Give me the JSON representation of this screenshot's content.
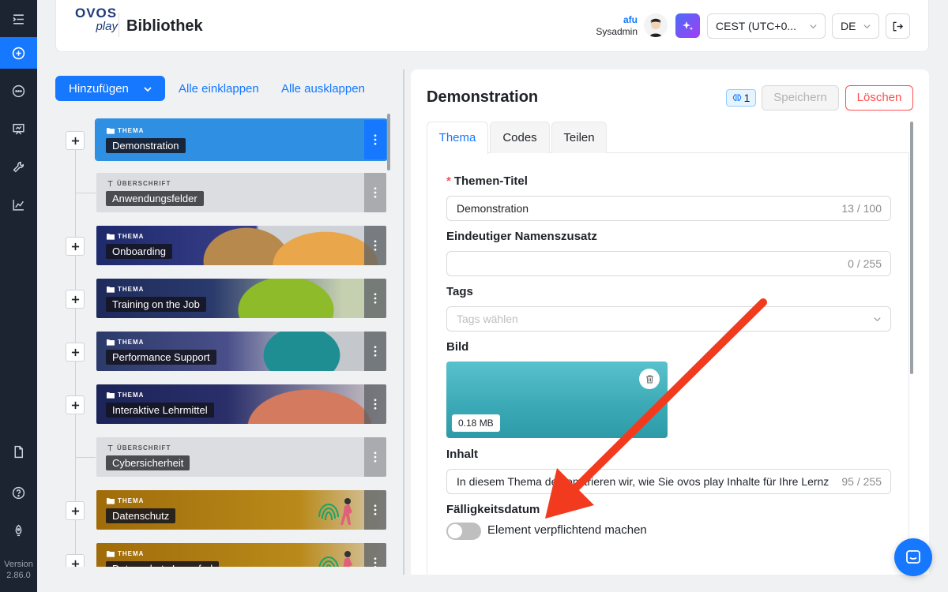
{
  "app": {
    "title": "Bibliothek",
    "logo_line1": "OVOS",
    "logo_line2": "play",
    "version_label": "Version",
    "version": "2.86.0"
  },
  "sidebar": {
    "items": [
      {
        "icon": "menu-fold-icon"
      },
      {
        "icon": "plus-circle-icon",
        "active": true
      },
      {
        "icon": "message-icon"
      },
      {
        "icon": "presentation-icon"
      },
      {
        "icon": "tool-icon"
      },
      {
        "icon": "line-chart-icon"
      },
      {
        "icon": "file-icon"
      },
      {
        "icon": "question-circle-icon"
      },
      {
        "icon": "rocket-icon"
      }
    ]
  },
  "header": {
    "user_name": "afu",
    "user_role": "Sysadmin",
    "timezone": "CEST (UTC+0...",
    "language": "DE"
  },
  "library": {
    "add_label": "Hinzufügen",
    "collapse_all": "Alle einklappen",
    "expand_all": "Alle ausklappen",
    "items": [
      {
        "type": "THEMA",
        "label": "Demonstration",
        "selected": true
      },
      {
        "type": "ÜBERSCHRIFT",
        "label": "Anwendungsfelder"
      },
      {
        "type": "THEMA",
        "label": "Onboarding"
      },
      {
        "type": "THEMA",
        "label": "Training on the Job"
      },
      {
        "type": "THEMA",
        "label": "Performance Support"
      },
      {
        "type": "THEMA",
        "label": "Interaktive Lehrmittel"
      },
      {
        "type": "ÜBERSCHRIFT",
        "label": "Cybersicherheit"
      },
      {
        "type": "THEMA",
        "label": "Datenschutz"
      },
      {
        "type": "THEMA",
        "label": "Datenschutz Lernpfad"
      }
    ]
  },
  "detail": {
    "title": "Demonstration",
    "badge_count": "1",
    "save_label": "Speichern",
    "delete_label": "Löschen",
    "tabs": [
      "Thema",
      "Codes",
      "Teilen"
    ],
    "fields": {
      "title_label": "Themen-Titel",
      "title_value": "Demonstration",
      "title_count": "13 / 100",
      "suffix_label": "Eindeutiger Namenszusatz",
      "suffix_value": "",
      "suffix_count": "0 / 255",
      "tags_label": "Tags",
      "tags_placeholder": "Tags wählen",
      "image_label": "Bild",
      "image_size": "0.18 MB",
      "content_label": "Inhalt",
      "content_value": "In diesem Thema demonstrieren wir, wie Sie ovos play Inhalte für Ihre Lernz",
      "content_count": "95 / 255",
      "due_label": "Fälligkeitsdatum",
      "mandatory_label": "Element verpflichtend machen"
    }
  },
  "colors": {
    "accent": "#1677ff",
    "danger": "#ff4d4f",
    "sidebar_bg": "#1b2430",
    "arrow": "#f23a1f"
  }
}
